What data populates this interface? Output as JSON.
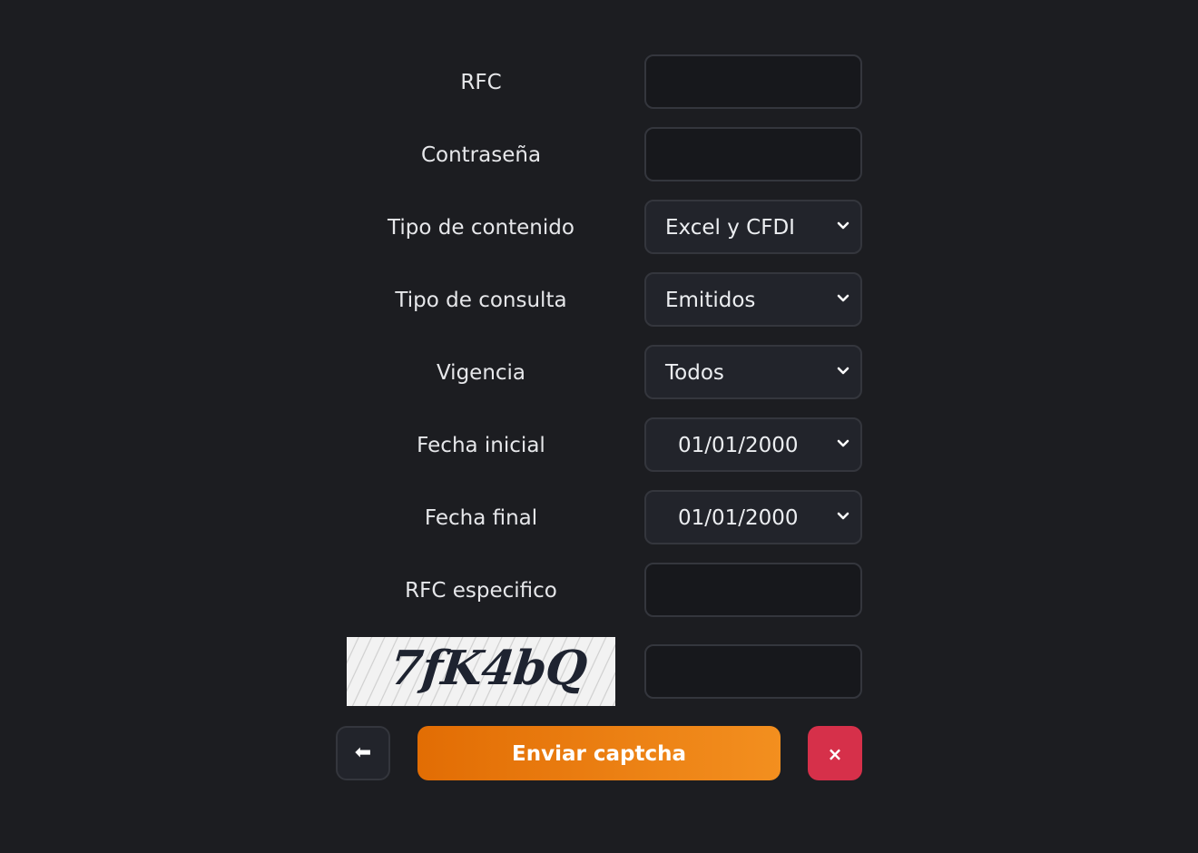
{
  "form": {
    "rfc": {
      "label": "RFC",
      "value": ""
    },
    "password": {
      "label": "Contraseña",
      "value": ""
    },
    "content_type": {
      "label": "Tipo de contenido",
      "selected": "Excel y CFDI"
    },
    "query_type": {
      "label": "Tipo de consulta",
      "selected": "Emitidos"
    },
    "validity": {
      "label": "Vigencia",
      "selected": "Todos"
    },
    "start_date": {
      "label": "Fecha inicial",
      "selected": "01/01/2000"
    },
    "end_date": {
      "label": "Fecha final",
      "selected": "01/01/2000"
    },
    "specific_rfc": {
      "label": "RFC especifico",
      "value": ""
    }
  },
  "captcha": {
    "image_text": "7fK4bQ",
    "input_value": ""
  },
  "actions": {
    "back_icon": "left-arrow-icon",
    "back_glyph": "⬅",
    "submit_label": "Enviar captcha",
    "close_icon": "close-icon",
    "close_glyph": "×"
  },
  "colors": {
    "background": "#1c1d21",
    "submit_start": "#e26d04",
    "submit_end": "#f38f1f",
    "close": "#d6304a"
  }
}
